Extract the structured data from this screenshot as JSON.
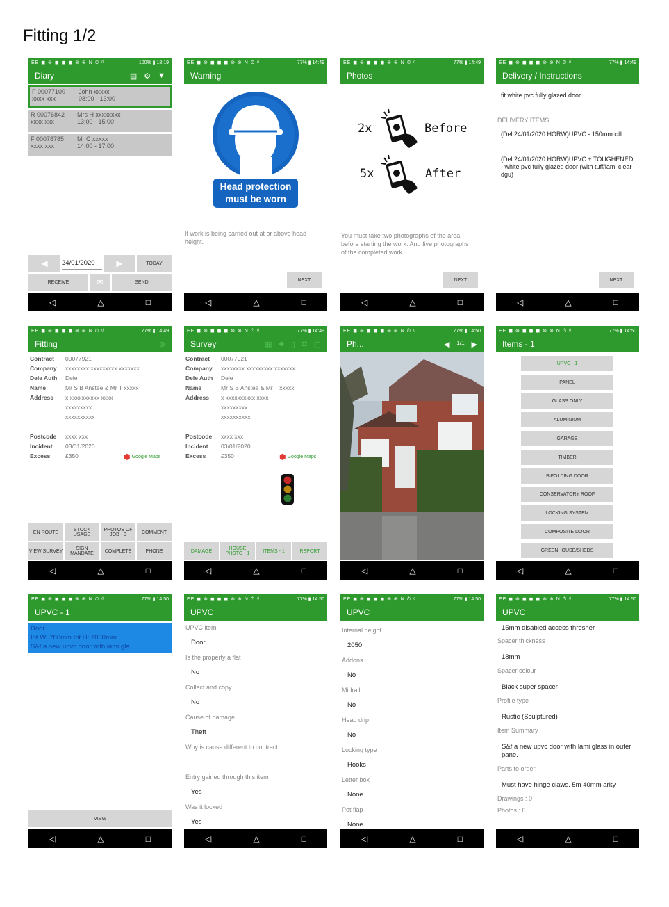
{
  "doc_title": "Fitting 1/2",
  "status": {
    "left": "EE ◼ ⊛ ◼ ◼ ◼ ⊛ ⊛ N ⏱ ᵈ",
    "right_a": "100% ▮ 18:19",
    "right_b": "77% ▮ 14:49",
    "right_c": "77% ▮ 14:50"
  },
  "nav": {
    "back": "◁",
    "home": "△",
    "recent": "□"
  },
  "diary": {
    "title": "Diary",
    "rows": [
      {
        "code": "F  00077100",
        "name": "John xxxxx",
        "loc": "xxxx xxx",
        "time": "08:00 - 13:00"
      },
      {
        "code": "R  00076842",
        "name": "Mrs H xxxxxxxx",
        "loc": "xxxx xxx",
        "time": "13:00 - 15:00"
      },
      {
        "code": "F  00078785",
        "name": "Mr C xxxxx",
        "loc": "xxxx xxx",
        "time": "14:00 - 17:00"
      }
    ],
    "date": "24/01/2020",
    "today": "TODAY",
    "receive": "RECEIVE",
    "send": "SEND"
  },
  "warning": {
    "title": "Warning",
    "sign_text": "Head protection must be worn",
    "text": "If work is being carried out at or above head height.",
    "next": "NEXT"
  },
  "photos": {
    "title": "Photos",
    "before_count": "2x",
    "before_label": "Before",
    "after_count": "5x",
    "after_label": "After",
    "text": "You must take two photographs of the area before starting the work. And five photographs of the completed work.",
    "next": "NEXT"
  },
  "delivery": {
    "title": "Delivery / Instructions",
    "note": "fit white pvc fully glazed door.",
    "items_header": "DELIVERY ITEMS",
    "item1": "(Del:24/01/2020 HORW)UPVC - 150mm cill",
    "item2": "(Del:24/01/2020 HORW)UPVC + TOUGHENED - white pvc fully glazed door (with tuff/lami clear dgu)",
    "next": "NEXT"
  },
  "job": {
    "contract_k": "Contract",
    "contract_v": "00077921",
    "company_k": "Company",
    "company_v": "xxxxxxxx xxxxxxxxx xxxxxxx",
    "deleauth_k": "Dele Auth",
    "deleauth_v": "Dele",
    "name_k": "Name",
    "name_v": "Mr S B Anstee & Mr T xxxxx",
    "address_k": "Address",
    "address_v1": "x xxxxxxxxxx xxxx",
    "address_v2": "xxxxxxxxx",
    "address_v3": "xxxxxxxxxx",
    "postcode_k": "Postcode",
    "postcode_v": "xxxx xxx",
    "incident_k": "Incident",
    "incident_v": "03/01/2020",
    "excess_k": "Excess",
    "excess_v": "£350",
    "maps": "Google Maps"
  },
  "fitting": {
    "title": "Fitting",
    "btn_en_route": "EN ROUTE",
    "btn_stock": "STOCK USAGE",
    "btn_photos": "PHOTOS OF JOB - 0",
    "btn_comment": "COMMENT",
    "btn_view_survey": "VIEW SURVEY",
    "btn_sign": "SIGN MANDATE",
    "btn_complete": "COMPLETE",
    "btn_phone": "PHONE"
  },
  "survey": {
    "title": "Survey",
    "btn_damage": "DAMAGE",
    "btn_house": "HOUSE PHOTO - 1",
    "btn_items": "ITEMS - 1",
    "btn_report": "REPORT"
  },
  "photo_view": {
    "title": "Ph...",
    "counter": "1/1"
  },
  "items": {
    "title": "Items - 1",
    "list": [
      "UPVC - 1",
      "PANEL",
      "GLASS ONLY",
      "ALUMINIUM",
      "GARAGE",
      "TIMBER",
      "BIFOLDING DOOR",
      "CONSERVATORY ROOF",
      "LOCKING SYSTEM",
      "COMPOSITE DOOR",
      "GREENHOUSE/SHEDS"
    ]
  },
  "upvc1": {
    "title": "UPVC - 1",
    "line1": "Door",
    "line2": "Int W: 780mm    Int H: 2050mm",
    "line3": "S&f a new upvc door with lami gla...",
    "view": "VIEW"
  },
  "upvc_a": {
    "title": "UPVC",
    "fields": [
      {
        "label": "UPVC item",
        "value": "Door"
      },
      {
        "label": "Is the property a flat",
        "value": "No"
      },
      {
        "label": "Collect and copy",
        "value": "No"
      },
      {
        "label": "Cause of damage",
        "value": "Theft"
      },
      {
        "label": "Why is cause different to contract",
        "value": ""
      },
      {
        "label": "Entry gained through this item",
        "value": "Yes"
      },
      {
        "label": "Was it locked",
        "value": "Yes"
      }
    ]
  },
  "upvc_b": {
    "title": "UPVC",
    "fields": [
      {
        "label": "Internal height",
        "value": "2050"
      },
      {
        "label": "Addons",
        "value": "No"
      },
      {
        "label": "Midrail",
        "value": "No"
      },
      {
        "label": "Head drip",
        "value": "No"
      },
      {
        "label": "Locking type",
        "value": "Hooks"
      },
      {
        "label": "Letter box",
        "value": "None"
      },
      {
        "label": "Pet flap",
        "value": "None"
      }
    ]
  },
  "upvc_c": {
    "title": "UPVC",
    "first_value": "15mm disabled access thresher",
    "fields": [
      {
        "label": "Spacer thickness",
        "value": "18mm"
      },
      {
        "label": "Spacer colour",
        "value": "Black super spacer"
      },
      {
        "label": "Profile type",
        "value": "Rustic (Sculptured)"
      },
      {
        "label": "Item Summary",
        "value": "S&f a new upvc door with lami glass in outer pane."
      },
      {
        "label": "Parts to order",
        "value": "Must have hinge claws. 5m 40mm arky"
      }
    ],
    "drawings": "Drawings : 0",
    "photos": "Photos : 0"
  }
}
